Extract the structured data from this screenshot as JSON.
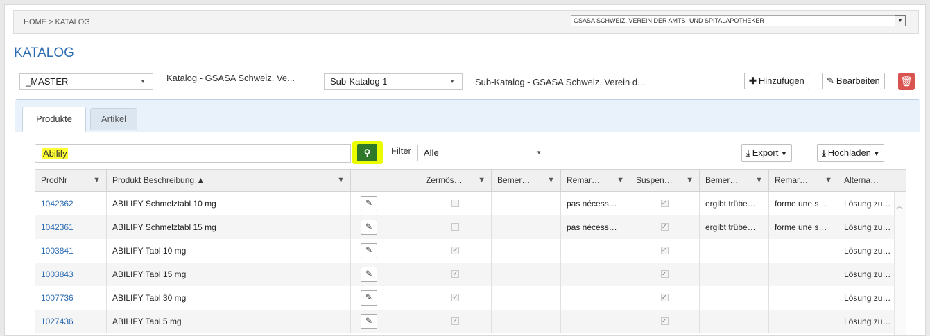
{
  "breadcrumb": "HOME > KATALOG",
  "org_select": {
    "value": "GSASA SCHWEIZ. VEREIN DER AMTS- UND SPITALAPOTHEKER"
  },
  "page_title": "KATALOG",
  "catalog": {
    "master_select": "_MASTER",
    "master_desc": "Katalog - GSASA Schweiz. Ve...",
    "sub_select": "Sub-Katalog 1",
    "sub_desc": "Sub-Katalog - GSASA Schweiz. Verein d...",
    "add_label": "Hinzufügen",
    "edit_label": "Bearbeiten"
  },
  "tabs": [
    {
      "label": "Produkte",
      "active": true
    },
    {
      "label": "Artikel",
      "active": false
    }
  ],
  "search": {
    "value": "Abilify"
  },
  "filter": {
    "label": "Filter",
    "value": "Alle"
  },
  "toolbar": {
    "export_label": "Export",
    "upload_label": "Hochladen"
  },
  "columns": [
    {
      "label": "ProdNr",
      "filter": true
    },
    {
      "label": "Produkt Beschreibung ▲",
      "filter": true
    },
    {
      "label": "",
      "filter": false
    },
    {
      "label": "Zermös…",
      "filter": true
    },
    {
      "label": "Bemer…",
      "filter": true
    },
    {
      "label": "Remar…",
      "filter": true
    },
    {
      "label": "Suspen…",
      "filter": true
    },
    {
      "label": "Bemer…",
      "filter": true
    },
    {
      "label": "Remar…",
      "filter": true
    },
    {
      "label": "Alterna…",
      "filter": false
    }
  ],
  "rows": [
    {
      "prodnr": "1042362",
      "desc": "ABILIFY Schmelztabl 10 mg",
      "zermoes": false,
      "bemer1": "",
      "remar1": "pas nécess…",
      "suspen": true,
      "bemer2": "ergibt trübe…",
      "remar2": "forme une s…",
      "alterna": "Lösung zu…"
    },
    {
      "prodnr": "1042361",
      "desc": "ABILIFY Schmelztabl 15 mg",
      "zermoes": false,
      "bemer1": "",
      "remar1": "pas nécess…",
      "suspen": true,
      "bemer2": "ergibt trübe…",
      "remar2": "forme une s…",
      "alterna": "Lösung zu…"
    },
    {
      "prodnr": "1003841",
      "desc": "ABILIFY Tabl 10 mg",
      "zermoes": true,
      "bemer1": "",
      "remar1": "",
      "suspen": true,
      "bemer2": "",
      "remar2": "",
      "alterna": "Lösung zu…"
    },
    {
      "prodnr": "1003843",
      "desc": "ABILIFY Tabl 15 mg",
      "zermoes": true,
      "bemer1": "",
      "remar1": "",
      "suspen": true,
      "bemer2": "",
      "remar2": "",
      "alterna": "Lösung zu…"
    },
    {
      "prodnr": "1007736",
      "desc": "ABILIFY Tabl 30 mg",
      "zermoes": true,
      "bemer1": "",
      "remar1": "",
      "suspen": true,
      "bemer2": "",
      "remar2": "",
      "alterna": "Lösung zu…"
    },
    {
      "prodnr": "1027436",
      "desc": "ABILIFY Tabl 5 mg",
      "zermoes": true,
      "bemer1": "",
      "remar1": "",
      "suspen": true,
      "bemer2": "",
      "remar2": "",
      "alterna": "Lösung zu…"
    }
  ],
  "colors": {
    "accent": "#2d6cb3",
    "delete": "#d9534f",
    "search_highlight": "#ffff33",
    "search_button": "#2f7a2a"
  }
}
